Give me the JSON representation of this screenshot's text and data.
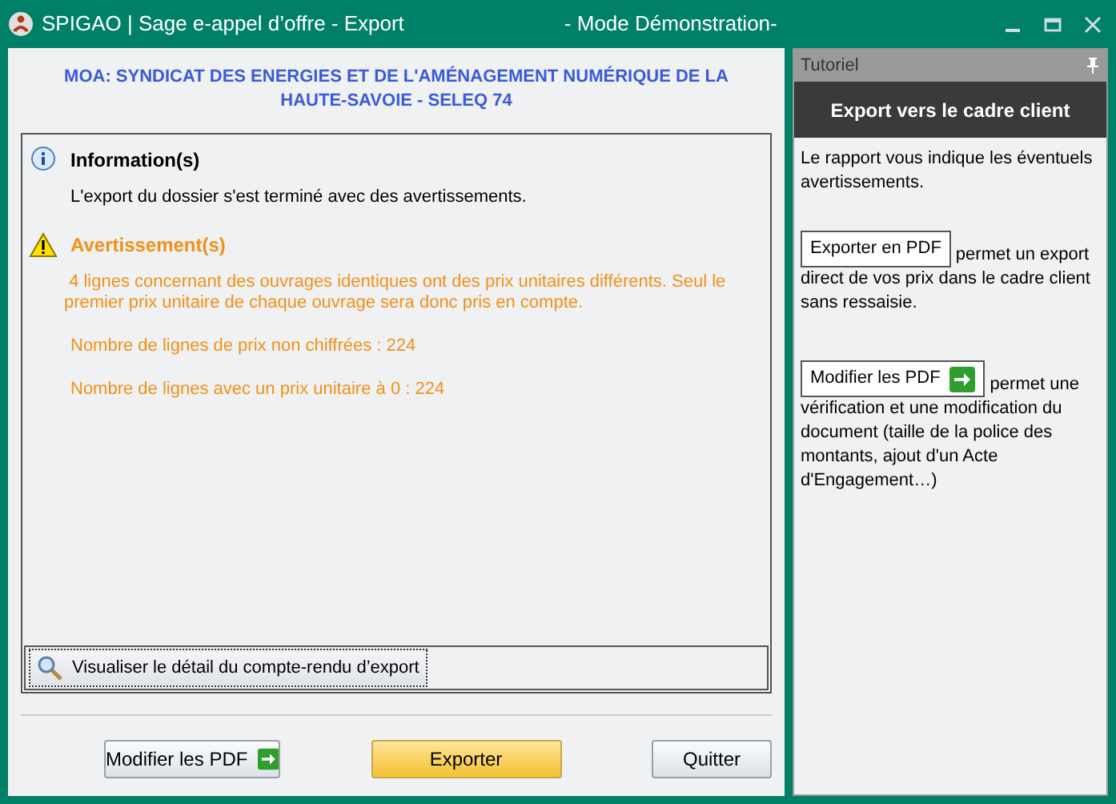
{
  "window": {
    "title": "SPIGAO | Sage e-appel d’offre - Export",
    "mode": "- Mode Démonstration-"
  },
  "header": "MOA: SYNDICAT DES ENERGIES ET DE L'AMÉNAGEMENT NUMÉRIQUE DE LA HAUTE-SAVOIE - SELEQ 74",
  "report": [
    {
      "kind": "info",
      "title": "Information(s)",
      "messages": [
        "L'export du dossier s'est terminé avec des avertissements."
      ]
    },
    {
      "kind": "warning",
      "title": "Avertissement(s)",
      "messages": [
        " 4 lignes concernant des ouvrages identiques ont des prix unitaires différents. Seul le premier prix unitaire de chaque ouvrage sera donc pris en compte.",
        "Nombre de lignes de prix non chiffrées : 224",
        "Nombre de lignes avec un prix unitaire à 0 : 224"
      ]
    }
  ],
  "detail_button": "Visualiser le détail du compte-rendu d’export",
  "buttons": [
    {
      "label": "Modifier les PDF",
      "kind": "arrow"
    },
    {
      "label": "Exporter",
      "kind": "primary"
    },
    {
      "label": "Quitter",
      "kind": "plain"
    }
  ],
  "tutorial": {
    "title": "Tutoriel",
    "heading": "Export vers le cadre client",
    "intro": "Le rapport vous indique les éventuels avertissements.",
    "items": [
      {
        "button": "Exporter en PDF",
        "kind": "plain",
        "text": [
          "permet un export",
          "direct de vos prix dans le cadre client sans ressaisie."
        ]
      },
      {
        "button": "Modifier les PDF",
        "kind": "arrow",
        "text": [
          "permet une",
          "vérification et une modification du document (taille de la police des montants, ajout d'un Acte d'Engagement…)"
        ]
      }
    ]
  }
}
